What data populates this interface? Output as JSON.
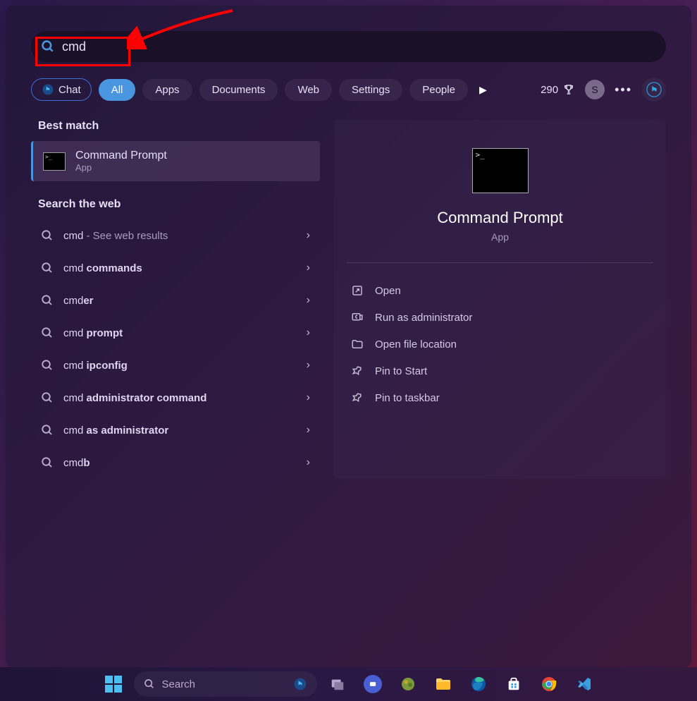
{
  "search": {
    "query": "cmd"
  },
  "tabs": {
    "chat": "Chat",
    "items": [
      "All",
      "Apps",
      "Documents",
      "Web",
      "Settings",
      "People"
    ],
    "activeIndex": 0
  },
  "header": {
    "points": "290",
    "userInitial": "S"
  },
  "bestMatch": {
    "heading": "Best match",
    "title": "Command Prompt",
    "subtitle": "App"
  },
  "webSearch": {
    "heading": "Search the web",
    "items": [
      {
        "prefix": "cmd",
        "bold": "",
        "suffix": " - See web results"
      },
      {
        "prefix": "cmd ",
        "bold": "commands",
        "suffix": ""
      },
      {
        "prefix": "cmd",
        "bold": "er",
        "suffix": ""
      },
      {
        "prefix": "cmd ",
        "bold": "prompt",
        "suffix": ""
      },
      {
        "prefix": "cmd ",
        "bold": "ipconfig",
        "suffix": ""
      },
      {
        "prefix": "cmd ",
        "bold": "administrator command",
        "suffix": ""
      },
      {
        "prefix": "cmd ",
        "bold": "as administrator",
        "suffix": ""
      },
      {
        "prefix": "cmd",
        "bold": "b",
        "suffix": ""
      }
    ]
  },
  "detail": {
    "title": "Command Prompt",
    "subtitle": "App",
    "actions": [
      "Open",
      "Run as administrator",
      "Open file location",
      "Pin to Start",
      "Pin to taskbar"
    ]
  },
  "taskbar": {
    "searchPlaceholder": "Search"
  }
}
